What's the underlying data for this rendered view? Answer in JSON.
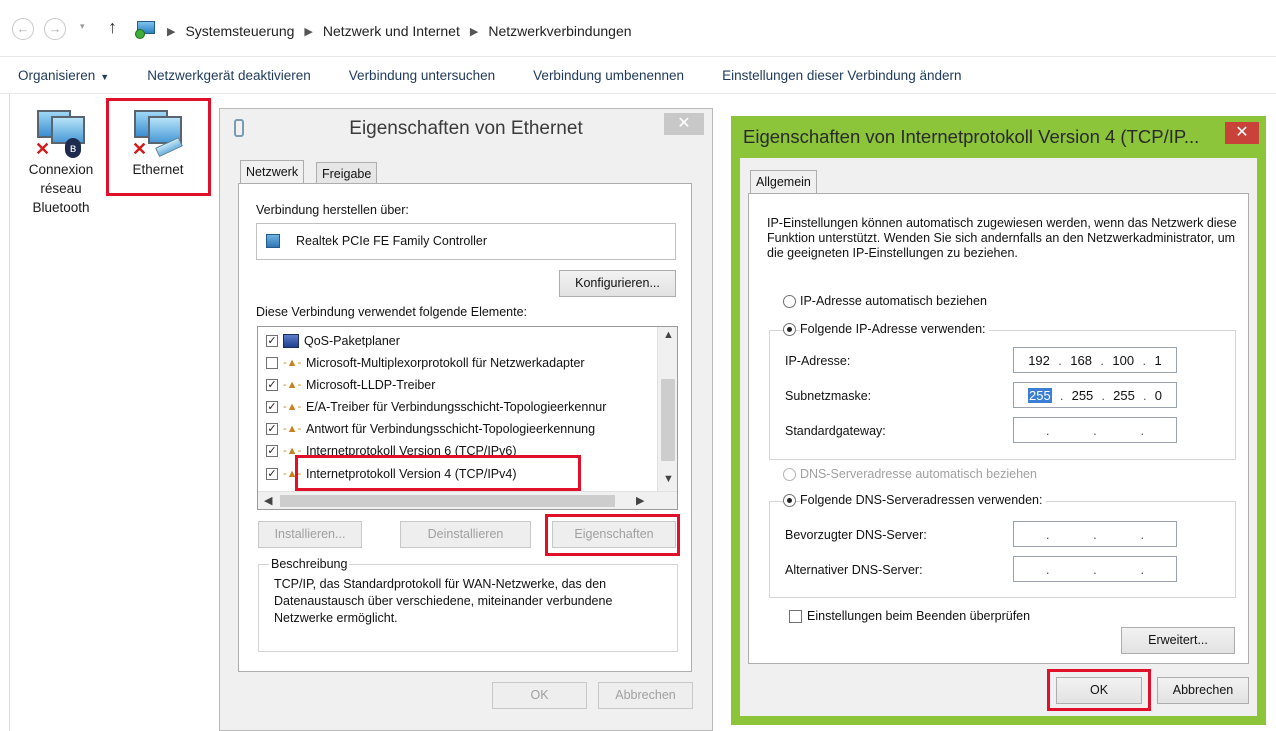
{
  "address_bar": {
    "back_icon": "back-arrow-icon",
    "forward_icon": "forward-arrow-icon",
    "up_icon": "up-arrow-icon",
    "breadcrumb": [
      "Systemsteuerung",
      "Netzwerk und Internet",
      "Netzwerkverbindungen"
    ]
  },
  "command_bar": {
    "organize": "Organisieren",
    "items": [
      "Netzwerkgerät deaktivieren",
      "Verbindung untersuchen",
      "Verbindung umbenennen",
      "Einstellungen dieser Verbindung ändern"
    ]
  },
  "adapters": [
    {
      "label_lines": [
        "Connexion",
        "réseau",
        "Bluetooth"
      ]
    },
    {
      "label_lines": [
        "Ethernet"
      ]
    }
  ],
  "ethernet_dialog": {
    "title": "Eigenschaften von Ethernet",
    "close": "✕",
    "tabs": [
      "Netzwerk",
      "Freigabe"
    ],
    "connect_using_label": "Verbindung herstellen über:",
    "adapter_name": "Realtek PCIe FE Family Controller",
    "configure_button": "Konfigurieren...",
    "elements_label": "Diese Verbindung verwendet folgende Elemente:",
    "elements": [
      {
        "checked": true,
        "label": "QoS-Paketplaner"
      },
      {
        "checked": false,
        "label": "Microsoft-Multiplexorprotokoll für Netzwerkadapter"
      },
      {
        "checked": true,
        "label": "Microsoft-LLDP-Treiber"
      },
      {
        "checked": true,
        "label": "E/A-Treiber für Verbindungsschicht-Topologieerkennur"
      },
      {
        "checked": true,
        "label": "Antwort für Verbindungsschicht-Topologieerkennung"
      },
      {
        "checked": true,
        "label": "Internetprotokoll Version 6 (TCP/IPv6)"
      },
      {
        "checked": true,
        "label": "Internetprotokoll Version 4 (TCP/IPv4)"
      }
    ],
    "install_button": "Installieren...",
    "uninstall_button": "Deinstallieren",
    "properties_button": "Eigenschaften",
    "description_title": "Beschreibung",
    "description_text": "TCP/IP, das Standardprotokoll für WAN-Netzwerke, das den Datenaustausch über verschiedene, miteinander verbundene Netzwerke ermöglicht.",
    "ok_button": "OK",
    "cancel_button": "Abbrechen"
  },
  "ipv4_dialog": {
    "title": "Eigenschaften von Internetprotokoll Version 4 (TCP/IP...",
    "close": "✕",
    "tab": "Allgemein",
    "intro": "IP-Einstellungen können automatisch zugewiesen werden, wenn das Netzwerk diese Funktion unterstützt. Wenden Sie sich andernfalls an den Netzwerkadministrator, um die geeigneten IP-Einstellungen zu beziehen.",
    "auto_ip": "IP-Adresse automatisch beziehen",
    "manual_ip": "Folgende IP-Adresse verwenden:",
    "ip_label": "IP-Adresse:",
    "ip_value": [
      "192",
      "168",
      "100",
      "1"
    ],
    "subnet_label": "Subnetzmaske:",
    "subnet_value": [
      "255",
      "255",
      "255",
      "0"
    ],
    "gateway_label": "Standardgateway:",
    "auto_dns": "DNS-Serveradresse automatisch beziehen",
    "manual_dns": "Folgende DNS-Serveradressen verwenden:",
    "preferred_dns_label": "Bevorzugter DNS-Server:",
    "alternate_dns_label": "Alternativer DNS-Server:",
    "validate_label": "Einstellungen beim Beenden überprüfen",
    "advanced_button": "Erweitert...",
    "ok_button": "OK",
    "cancel_button": "Abbrechen",
    "frame_color": "#8cc43a"
  },
  "highlight_color": "#e0102a"
}
